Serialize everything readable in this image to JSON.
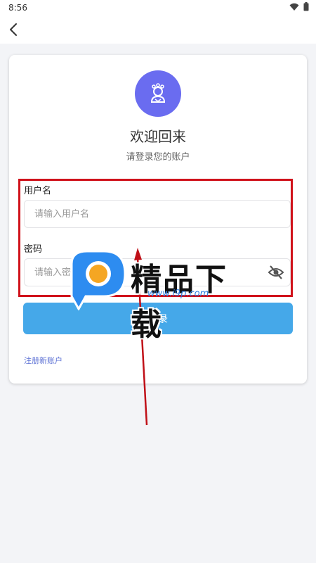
{
  "status_bar": {
    "time": "8:56"
  },
  "colors": {
    "accent": "#45a8e9",
    "avatar": "#6a6cf0",
    "link": "#5a6fd4",
    "highlight": "#d0121b"
  },
  "icons": {
    "back": "back-arrow-icon",
    "avatar": "user-avatar-icon",
    "password_toggle": "eye-off-icon"
  },
  "login": {
    "title": "欢迎回来",
    "subtitle": "请登录您的账户",
    "username_label": "用户名",
    "username_placeholder": "请输入用户名",
    "password_label": "密码",
    "password_placeholder": "请输入密码",
    "submit_label": "登录",
    "register_link": "注册新账户"
  },
  "watermark": {
    "brand": "精品下载",
    "url": "www.i9p.com"
  }
}
